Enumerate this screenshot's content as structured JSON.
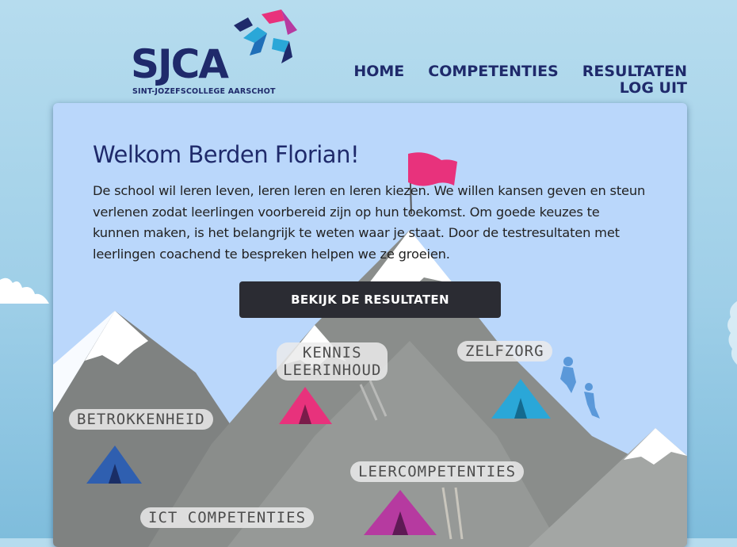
{
  "logo": {
    "name": "SJCA",
    "subtitle": "SINT-JOZEFSCOLLEGE AARSCHOT"
  },
  "nav": {
    "home": "HOME",
    "competenties": "COMPETENTIES",
    "resultaten": "RESULTATEN",
    "logout": "LOG UIT"
  },
  "main": {
    "title": "Welkom Berden Florian!",
    "intro": "De school wil leren leven, leren leren en leren kiezen. We willen kansen geven en steun verlenen zodat leerlingen voorbereid zijn op hun toekomst. Om goede keuzes te kunnen maken, is het belangrijk te weten waar je staat. Door de testresultaten met leerlingen coachend te bespreken helpen we ze groeien.",
    "cta": "BEKIJK DE RESULTATEN"
  },
  "camps": {
    "kennis_line1": "KENNIS",
    "kennis_line2": "LEERINHOUD",
    "zelfzorg": "ZELFZORG",
    "betrokkenheid": "BETROKKENHEID",
    "leercompetenties": "LEERCOMPETENTIES",
    "ict": "ICT COMPETENTIES"
  },
  "colors": {
    "navy": "#1f2a6b",
    "pink": "#e8327c",
    "cyan": "#2aa7d8",
    "card": "#bad7fb",
    "button": "#2b2c33"
  }
}
